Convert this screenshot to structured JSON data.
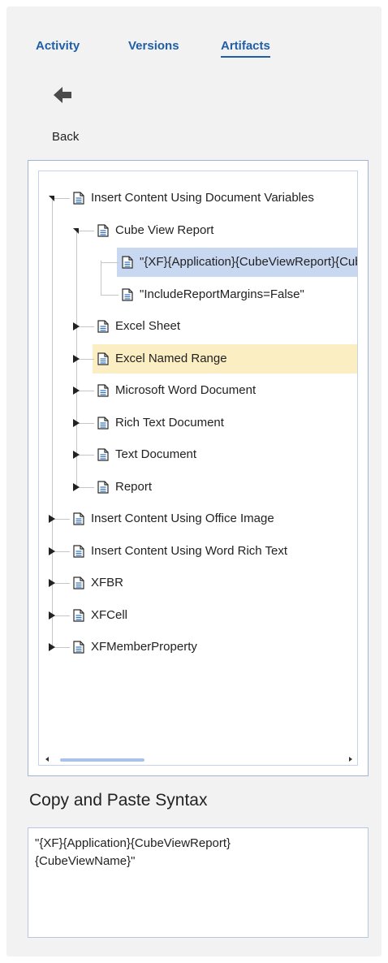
{
  "tabs": [
    {
      "label": "Activity",
      "active": false
    },
    {
      "label": "Versions",
      "active": false
    },
    {
      "label": "Artifacts",
      "active": true
    }
  ],
  "back": {
    "label": "Back",
    "icon": "back-arrow-icon"
  },
  "tree": {
    "nodes": [
      {
        "label": "Insert Content Using Document Variables",
        "state": "expanded"
      },
      {
        "label": "Cube View Report",
        "state": "expanded"
      },
      {
        "label": "\"{XF}{Application}{CubeViewReport}{CubeViewName}\"",
        "state": "leaf",
        "selected": true
      },
      {
        "label": "\"IncludeReportMargins=False\"",
        "state": "leaf"
      },
      {
        "label": "Excel Sheet",
        "state": "collapsed"
      },
      {
        "label": "Excel Named Range",
        "state": "collapsed",
        "hovered": true
      },
      {
        "label": "Microsoft Word Document",
        "state": "collapsed"
      },
      {
        "label": "Rich Text Document",
        "state": "collapsed"
      },
      {
        "label": "Text Document",
        "state": "collapsed"
      },
      {
        "label": "Report",
        "state": "collapsed"
      },
      {
        "label": "Insert Content Using Office Image",
        "state": "collapsed"
      },
      {
        "label": "Insert Content Using Word Rich Text",
        "state": "collapsed"
      },
      {
        "label": "XFBR",
        "state": "collapsed"
      },
      {
        "label": "XFCell",
        "state": "collapsed"
      },
      {
        "label": "XFMemberProperty",
        "state": "collapsed"
      }
    ]
  },
  "syntax": {
    "title": "Copy and Paste Syntax",
    "value": "\"{XF}{Application}{CubeViewReport}\n{CubeViewName}\""
  },
  "colors": {
    "tab_text": "#1f5fa6",
    "selected_row": "#c9d8f1",
    "hovered_row": "#fbeec3",
    "panel_bg": "#f2f2f2"
  }
}
